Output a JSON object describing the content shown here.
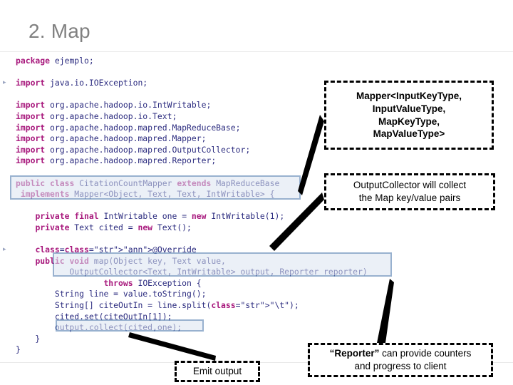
{
  "slide": {
    "title": "2. Map"
  },
  "code": {
    "language": "java",
    "lines": [
      {
        "indent": 0,
        "gutter": "",
        "text": "package ejemplo;"
      },
      {
        "indent": 0,
        "gutter": "",
        "text": ""
      },
      {
        "indent": 0,
        "gutter": "▸",
        "text": "import java.io.IOException;"
      },
      {
        "indent": 0,
        "gutter": "",
        "text": ""
      },
      {
        "indent": 0,
        "gutter": "",
        "text": "import org.apache.hadoop.io.IntWritable;"
      },
      {
        "indent": 0,
        "gutter": "",
        "text": "import org.apache.hadoop.io.Text;"
      },
      {
        "indent": 0,
        "gutter": "",
        "text": "import org.apache.hadoop.mapred.MapReduceBase;"
      },
      {
        "indent": 0,
        "gutter": "",
        "text": "import org.apache.hadoop.mapred.Mapper;"
      },
      {
        "indent": 0,
        "gutter": "",
        "text": "import org.apache.hadoop.mapred.OutputCollector;"
      },
      {
        "indent": 0,
        "gutter": "",
        "text": "import org.apache.hadoop.mapred.Reporter;"
      },
      {
        "indent": 0,
        "gutter": "",
        "text": ""
      },
      {
        "indent": 0,
        "gutter": "",
        "text": "public class CitationCountMapper extends MapReduceBase"
      },
      {
        "indent": 0,
        "gutter": "",
        "text": " implements Mapper<Object, Text, Text, IntWritable> {"
      },
      {
        "indent": 0,
        "gutter": "",
        "text": ""
      },
      {
        "indent": 0,
        "gutter": "",
        "text": "    private final IntWritable one = new IntWritable(1);"
      },
      {
        "indent": 0,
        "gutter": "",
        "text": "    private Text cited = new Text();"
      },
      {
        "indent": 0,
        "gutter": "",
        "text": ""
      },
      {
        "indent": 0,
        "gutter": "▸",
        "text": "    @Override"
      },
      {
        "indent": 0,
        "gutter": "",
        "text": "    public void map(Object key, Text value,"
      },
      {
        "indent": 0,
        "gutter": "",
        "text": "           OutputCollector<Text, IntWritable> output, Reporter reporter)"
      },
      {
        "indent": 0,
        "gutter": "",
        "text": "                  throws IOException {"
      },
      {
        "indent": 0,
        "gutter": "",
        "text": "        String line = value.toString();"
      },
      {
        "indent": 0,
        "gutter": "",
        "text": "        String[] citeOutIn = line.split(\"\\t\");"
      },
      {
        "indent": 0,
        "gutter": "",
        "text": "        cited.set(citeOutIn[1]);"
      },
      {
        "indent": 0,
        "gutter": "",
        "text": "        output.collect(cited,one);"
      },
      {
        "indent": 0,
        "gutter": "",
        "text": "    }"
      },
      {
        "indent": 0,
        "gutter": "",
        "text": "}"
      }
    ]
  },
  "highlights": [
    {
      "id": "class-declaration",
      "label": "class declaration highlight"
    },
    {
      "id": "map-signature",
      "label": "map method signature highlight"
    },
    {
      "id": "output-collect",
      "label": "output collect call highlight"
    }
  ],
  "callouts": {
    "mapper": {
      "lines": [
        "Mapper<InputKeyType,",
        "InputValueType,",
        "MapKeyType,",
        "MapValueType>"
      ]
    },
    "collector": {
      "lines": [
        "OutputCollector will collect",
        "the Map key/value pairs"
      ]
    },
    "reporter": {
      "quoted": "“Reporter”",
      "rest_line1": " can provide counters",
      "line2": "and progress to client"
    },
    "emit": {
      "label": "Emit output"
    }
  },
  "colors": {
    "title": "#808080",
    "code_text": "#2b2b7f",
    "keyword": "#a8197d",
    "highlight_fill": "#dbe5f1",
    "highlight_border": "#4472a8",
    "callout_border": "#000000",
    "background": "#ffffff"
  }
}
